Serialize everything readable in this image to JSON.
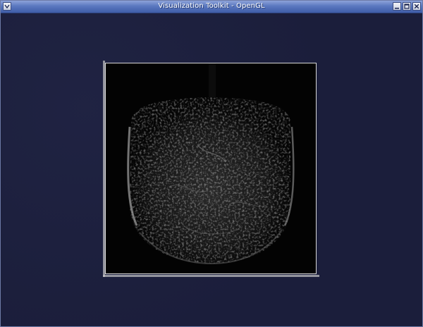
{
  "window": {
    "title": "Visualization Toolkit - OpenGL",
    "titlebar_color": "#5a77bf",
    "controls": {
      "menu_icon": "chevron-down-icon",
      "minimize_icon": "minimize-icon",
      "maximize_icon": "maximize-icon",
      "close_icon": "close-icon"
    }
  },
  "viewport": {
    "background_color": "#1b1e3b",
    "content": "image-slice",
    "slice_border_color": "#d8d8d8"
  }
}
